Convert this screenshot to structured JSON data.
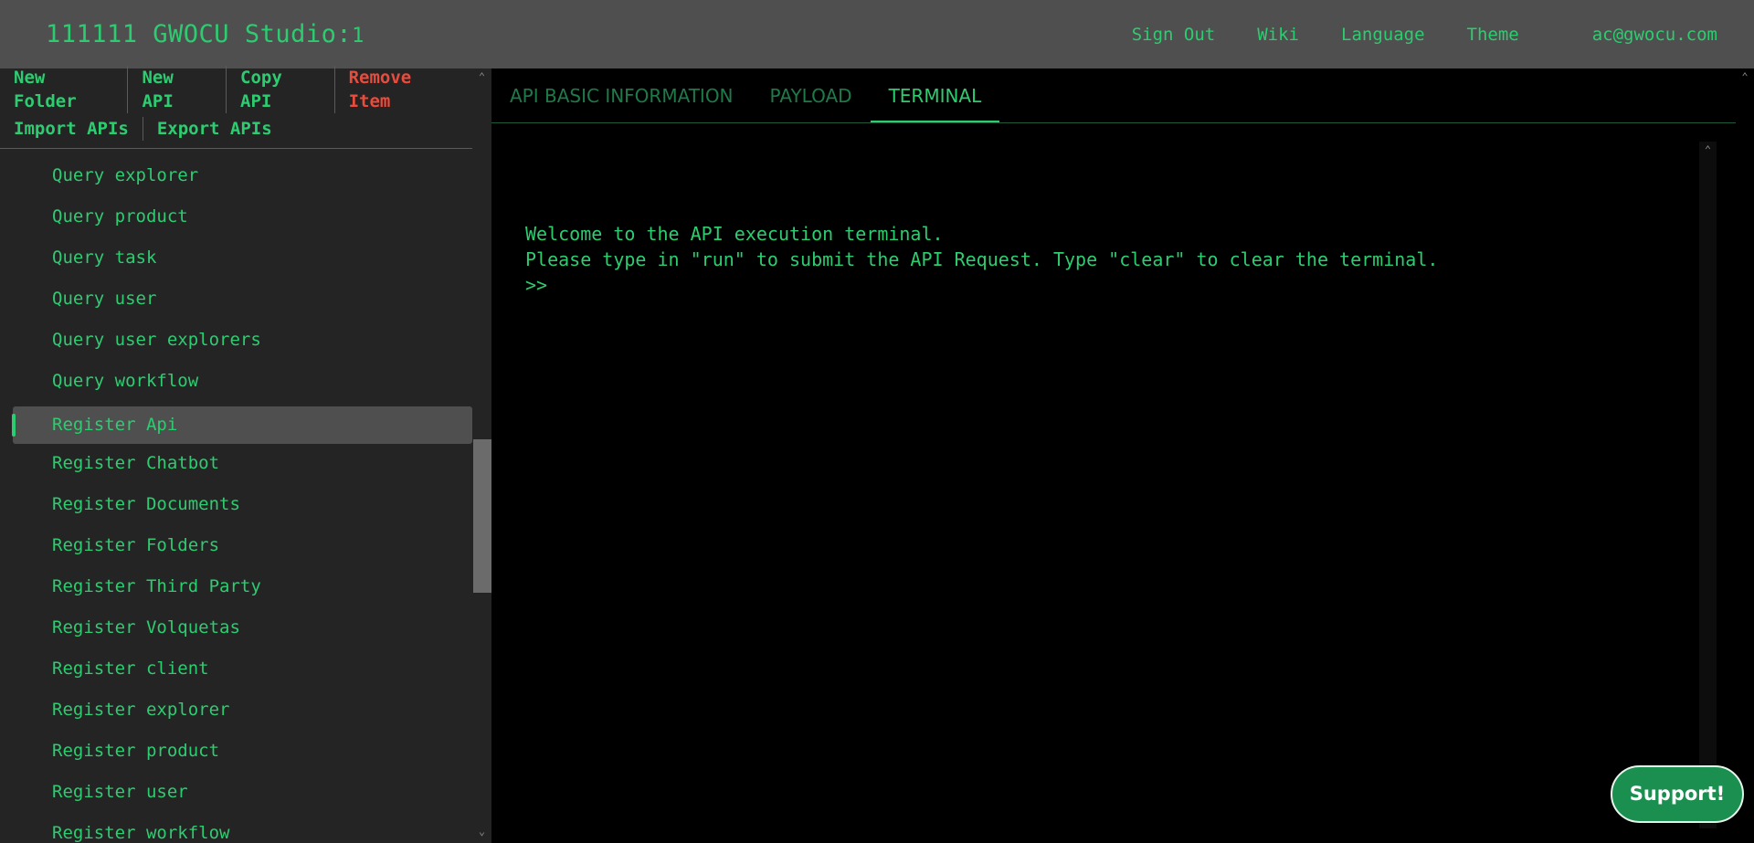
{
  "header": {
    "brand_name": "111111 GWOCU Studio:",
    "brand_number": "1",
    "nav": [
      {
        "label": "Sign Out"
      },
      {
        "label": "Wiki"
      },
      {
        "label": "Language"
      },
      {
        "label": "Theme"
      }
    ],
    "user_email": "ac@gwocu.com"
  },
  "toolbar": {
    "new_folder": "New Folder",
    "new_api": "New API",
    "copy_api": "Copy API",
    "remove_item": "Remove Item",
    "import_apis": "Import APIs",
    "export_apis": "Export APIs"
  },
  "tree": {
    "items": [
      {
        "label": "Query explorer"
      },
      {
        "label": "Query product"
      },
      {
        "label": "Query task"
      },
      {
        "label": "Query user"
      },
      {
        "label": "Query user explorers"
      },
      {
        "label": "Query workflow"
      },
      {
        "label": "Register Api"
      },
      {
        "label": "Register Chatbot"
      },
      {
        "label": "Register Documents"
      },
      {
        "label": "Register Folders"
      },
      {
        "label": "Register Third Party"
      },
      {
        "label": "Register Volquetas"
      },
      {
        "label": "Register client"
      },
      {
        "label": "Register explorer"
      },
      {
        "label": "Register product"
      },
      {
        "label": "Register user"
      },
      {
        "label": "Register workflow"
      }
    ],
    "selected_label": "Register Api"
  },
  "tabs": [
    {
      "label": "API BASIC INFORMATION"
    },
    {
      "label": "PAYLOAD"
    },
    {
      "label": "TERMINAL"
    }
  ],
  "active_tab": "TERMINAL",
  "terminal": {
    "lines": [
      "Welcome to the API execution terminal.",
      "Please type in \"run\" to submit the API Request. Type \"clear\" to clear the terminal.",
      ">>"
    ]
  },
  "support_label": "Support!",
  "colors": {
    "accent": "#2ecc71",
    "danger": "#e74c3c",
    "header_bg": "#4f4f4f",
    "sidebar_bg": "#242424",
    "terminal_bg": "#000000",
    "support_bg": "#1a8f4f"
  },
  "icons": {
    "scroll_up": "chevron-up-icon",
    "scroll_down": "chevron-down-icon"
  }
}
